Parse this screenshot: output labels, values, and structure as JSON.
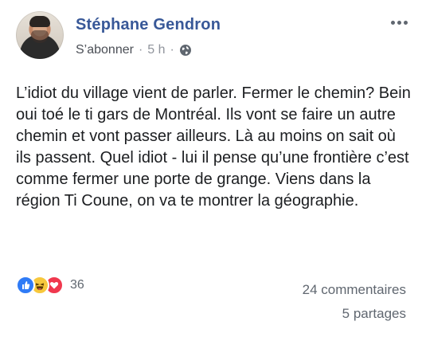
{
  "post": {
    "author": "Stéphane Gendron",
    "subscribe_label": "S’abonner",
    "separator": "·",
    "time": "5 h",
    "body": "L’idiot du village vient de parler. Fermer le chemin? Bein oui toé le ti gars de Montréal. Ils vont se faire un autre chemin et vont passer ailleurs. Là au moins on sait où ils passent. Quel idiot - lui il pense qu’une frontière c’est comme fermer une porte de grange. Viens dans la région Ti Coune, on va te montrer la géographie."
  },
  "engagement": {
    "reaction_icons": [
      "like-icon",
      "haha-icon",
      "love-icon"
    ],
    "reaction_count": "36",
    "comments": "24 commentaires",
    "shares": "5 partages"
  },
  "colors": {
    "author_blue": "#385898",
    "muted_gray": "#90949c",
    "like_blue": "#2f7bf6",
    "haha_yellow": "#f7c83d",
    "love_red": "#f0384e"
  }
}
